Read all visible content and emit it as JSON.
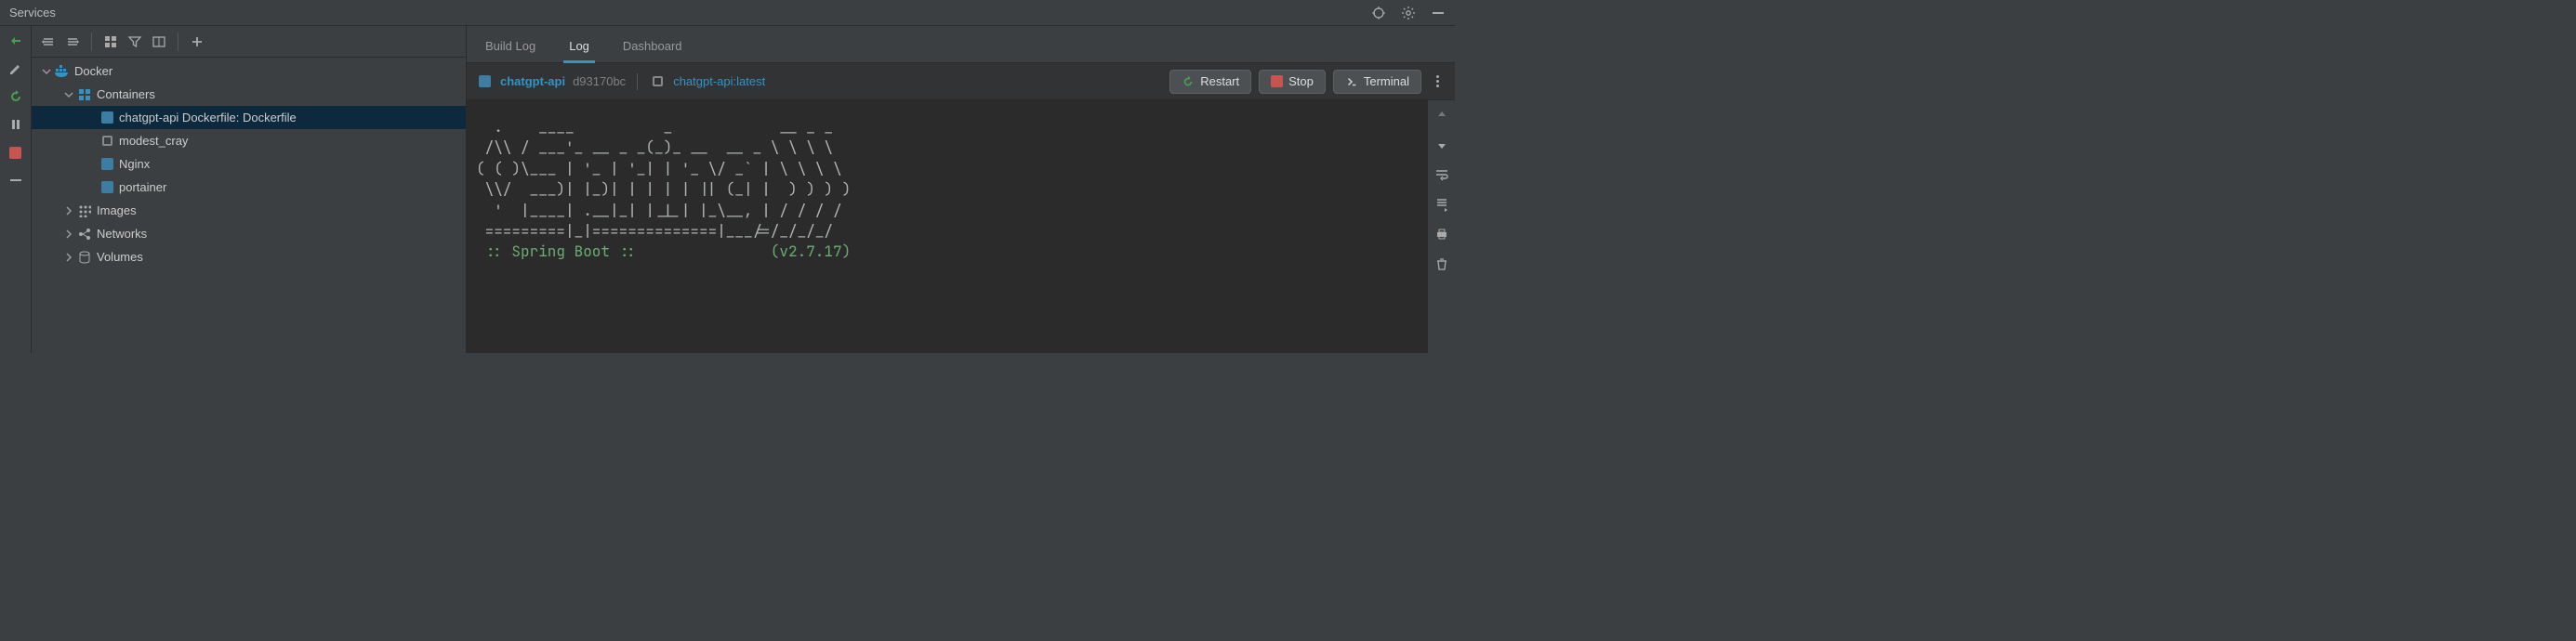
{
  "window": {
    "title": "Services"
  },
  "tree": {
    "root": "Docker",
    "containers_label": "Containers",
    "containers": [
      {
        "label": "chatgpt-api Dockerfile: Dockerfile",
        "status": "running",
        "selected": true
      },
      {
        "label": "modest_cray",
        "status": "stopped",
        "selected": false
      },
      {
        "label": "Nginx",
        "status": "running",
        "selected": false
      },
      {
        "label": "portainer",
        "status": "running",
        "selected": false
      }
    ],
    "images_label": "Images",
    "networks_label": "Networks",
    "volumes_label": "Volumes"
  },
  "tabs": [
    {
      "id": "build-log",
      "label": "Build Log",
      "active": false
    },
    {
      "id": "log",
      "label": "Log",
      "active": true
    },
    {
      "id": "dashboard",
      "label": "Dashboard",
      "active": false
    }
  ],
  "info": {
    "container_name": "chatgpt-api",
    "container_hash": "d93170bc",
    "image_name": "chatgpt-api:latest"
  },
  "buttons": {
    "restart": "Restart",
    "stop": "Stop",
    "terminal": "Terminal"
  },
  "log": {
    "ascii": "  .    ____          _            __ _ _\n /\\\\ / ___'_ __ _ _(_)_ __  __ _ \\ \\ \\ \\\n( ( )\\___ | '_ | '_| | '_ \\/ _` | \\ \\ \\ \\\n \\\\/  ___)| |_)| | | | | || (_| |  ) ) ) )\n  '  |____| .__|_| |_|_| |_\\__, | / / / /\n =========|_|==============|___/=/_/_/_/",
    "spring_line": " :: Spring Boot ::               (v2.7.17)"
  }
}
